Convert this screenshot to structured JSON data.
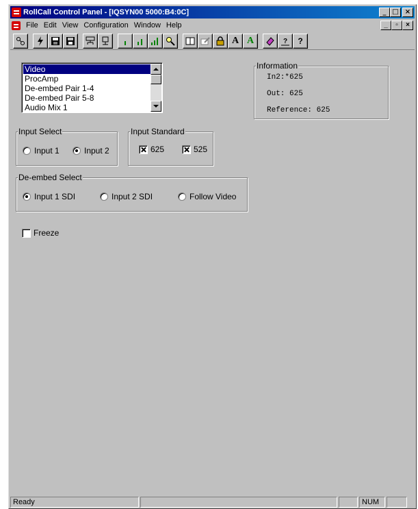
{
  "window": {
    "title": "RollCall Control Panel - [IQSYN00 5000:B4:0C]",
    "controls": {
      "minimize": "_",
      "maximize": "□",
      "close": "×"
    }
  },
  "menu": {
    "items": [
      {
        "id": "file",
        "label": "File"
      },
      {
        "id": "edit",
        "label": "Edit"
      },
      {
        "id": "view",
        "label": "View"
      },
      {
        "id": "configuration",
        "label": "Configuration"
      },
      {
        "id": "window",
        "label": "Window"
      },
      {
        "id": "help",
        "label": "Help"
      }
    ],
    "mdi_controls": {
      "minimize": "_",
      "restore": "▫",
      "close": "×"
    }
  },
  "toolbar": {
    "text_a_label": "A",
    "text_a_green_label": "A",
    "help_label": "?"
  },
  "panel_list": {
    "items": [
      "Video",
      "ProcAmp",
      "De-embed Pair 1-4",
      "De-embed Pair 5-8",
      "Audio Mix 1"
    ],
    "selected": "Video"
  },
  "information": {
    "legend": "Information",
    "lines": [
      "In2:*625",
      "Out: 625",
      "Reference: 625"
    ]
  },
  "input_select": {
    "legend": "Input Select",
    "options": [
      "Input 1",
      "Input 2"
    ],
    "selected": "Input 2"
  },
  "input_standard": {
    "legend": "Input Standard",
    "options": [
      {
        "label": "625",
        "checked": true
      },
      {
        "label": "525",
        "checked": true
      }
    ]
  },
  "deembed_select": {
    "legend": "De-embed Select",
    "options": [
      "Input 1 SDI",
      "Input 2 SDI",
      "Follow Video"
    ],
    "selected": "Input 1 SDI"
  },
  "freeze": {
    "label": "Freeze",
    "checked": false
  },
  "status": {
    "message": "Ready",
    "num_indicator": "NUM"
  },
  "colors": {
    "titlebar_start": "#000080",
    "titlebar_end": "#1084d0",
    "face": "#c0c0c0",
    "selection": "#000080"
  }
}
